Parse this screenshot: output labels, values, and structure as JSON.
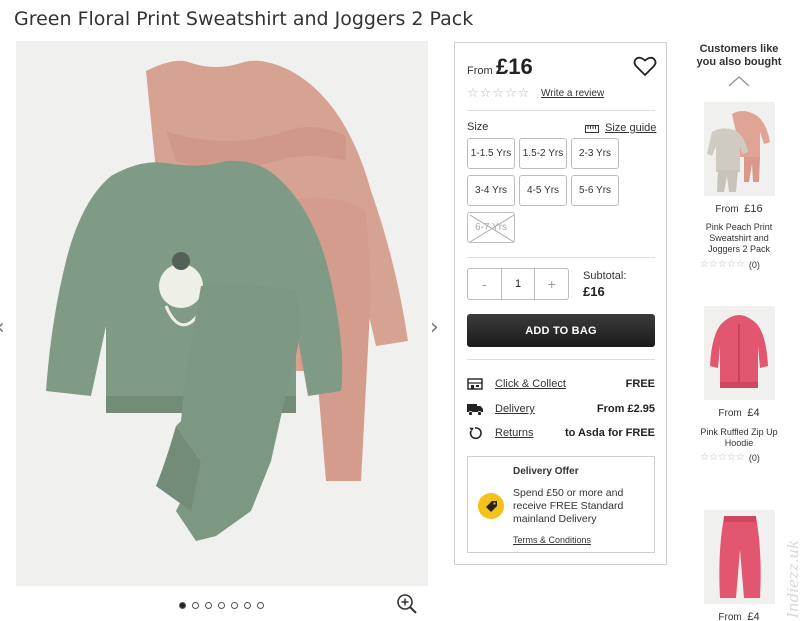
{
  "product": {
    "title": "Green Floral Print Sweatshirt and Joggers 2 Pack",
    "price_prefix": "From",
    "price": "£16",
    "review_link": "Write a review",
    "rating_stars": 0
  },
  "sizes": {
    "label": "Size",
    "guide_label": "Size guide",
    "options": [
      {
        "label": "1-1.5 Yrs",
        "available": true
      },
      {
        "label": "1.5-2 Yrs",
        "available": true
      },
      {
        "label": "2-3 Yrs",
        "available": true
      },
      {
        "label": "3-4 Yrs",
        "available": true
      },
      {
        "label": "4-5 Yrs",
        "available": true
      },
      {
        "label": "5-6 Yrs",
        "available": true
      },
      {
        "label": "6-7 Yrs",
        "available": false
      }
    ]
  },
  "quantity": {
    "minus": "-",
    "value": "1",
    "plus": "+"
  },
  "subtotal": {
    "label": "Subtotal:",
    "value": "£16"
  },
  "add_to_bag": "ADD TO BAG",
  "delivery": [
    {
      "icon": "shop-icon",
      "label": "Click & Collect",
      "value": "FREE"
    },
    {
      "icon": "truck-icon",
      "label": "Delivery",
      "value": "From £2.95"
    },
    {
      "icon": "returns-icon",
      "label": "Returns",
      "value": "to Asda for FREE"
    }
  ],
  "offer": {
    "title": "Delivery Offer",
    "text": "Spend £50 or more and receive FREE Standard mainland Delivery",
    "link": "Terms & Conditions",
    "icon": "price-tag-icon"
  },
  "gallery": {
    "dot_count": 7,
    "active_dot": 0,
    "prev_arrow": "‹",
    "next_arrow": "›"
  },
  "recommendations": {
    "title": "Customers like you also bought",
    "items": [
      {
        "price_prefix": "From",
        "price": "£16",
        "name": "Pink Peach Print Sweatshirt and Joggers 2 Pack",
        "review_count": "(0)"
      },
      {
        "price_prefix": "From",
        "price": "£4",
        "name": "Pink Ruffled Zip Up Hoodie",
        "review_count": "(0)"
      },
      {
        "price_prefix": "From",
        "price": "£4",
        "name": "",
        "review_count": ""
      }
    ]
  },
  "colors": {
    "accent": "#222222",
    "offer_icon": "#f2c21b",
    "sage": "#7f9a85",
    "pink": "#d7a093",
    "hot_pink": "#e2566f"
  }
}
